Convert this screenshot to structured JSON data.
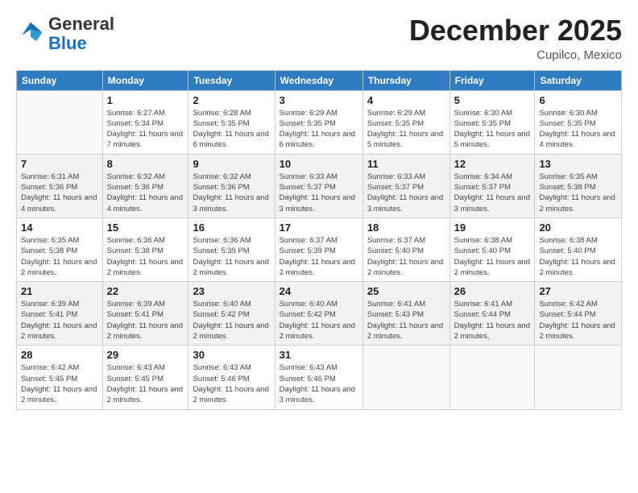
{
  "header": {
    "logo_general": "General",
    "logo_blue": "Blue",
    "month_title": "December 2025",
    "location": "Cupilco, Mexico"
  },
  "days_of_week": [
    "Sunday",
    "Monday",
    "Tuesday",
    "Wednesday",
    "Thursday",
    "Friday",
    "Saturday"
  ],
  "weeks": [
    {
      "row_class": "row-a",
      "days": [
        {
          "number": "",
          "empty": true
        },
        {
          "number": "1",
          "sunrise": "6:27 AM",
          "sunset": "5:34 PM",
          "daylight": "11 hours and 7 minutes."
        },
        {
          "number": "2",
          "sunrise": "6:28 AM",
          "sunset": "5:35 PM",
          "daylight": "11 hours and 6 minutes."
        },
        {
          "number": "3",
          "sunrise": "6:29 AM",
          "sunset": "5:35 PM",
          "daylight": "11 hours and 6 minutes."
        },
        {
          "number": "4",
          "sunrise": "6:29 AM",
          "sunset": "5:35 PM",
          "daylight": "11 hours and 5 minutes."
        },
        {
          "number": "5",
          "sunrise": "6:30 AM",
          "sunset": "5:35 PM",
          "daylight": "11 hours and 5 minutes."
        },
        {
          "number": "6",
          "sunrise": "6:30 AM",
          "sunset": "5:35 PM",
          "daylight": "11 hours and 4 minutes."
        }
      ]
    },
    {
      "row_class": "row-b",
      "days": [
        {
          "number": "7",
          "sunrise": "6:31 AM",
          "sunset": "5:36 PM",
          "daylight": "11 hours and 4 minutes."
        },
        {
          "number": "8",
          "sunrise": "6:32 AM",
          "sunset": "5:36 PM",
          "daylight": "11 hours and 4 minutes."
        },
        {
          "number": "9",
          "sunrise": "6:32 AM",
          "sunset": "5:36 PM",
          "daylight": "11 hours and 3 minutes."
        },
        {
          "number": "10",
          "sunrise": "6:33 AM",
          "sunset": "5:37 PM",
          "daylight": "11 hours and 3 minutes."
        },
        {
          "number": "11",
          "sunrise": "6:33 AM",
          "sunset": "5:37 PM",
          "daylight": "11 hours and 3 minutes."
        },
        {
          "number": "12",
          "sunrise": "6:34 AM",
          "sunset": "5:37 PM",
          "daylight": "11 hours and 3 minutes."
        },
        {
          "number": "13",
          "sunrise": "6:35 AM",
          "sunset": "5:38 PM",
          "daylight": "11 hours and 2 minutes."
        }
      ]
    },
    {
      "row_class": "row-c",
      "days": [
        {
          "number": "14",
          "sunrise": "6:35 AM",
          "sunset": "5:38 PM",
          "daylight": "11 hours and 2 minutes."
        },
        {
          "number": "15",
          "sunrise": "6:36 AM",
          "sunset": "5:38 PM",
          "daylight": "11 hours and 2 minutes."
        },
        {
          "number": "16",
          "sunrise": "6:36 AM",
          "sunset": "5:39 PM",
          "daylight": "11 hours and 2 minutes."
        },
        {
          "number": "17",
          "sunrise": "6:37 AM",
          "sunset": "5:39 PM",
          "daylight": "11 hours and 2 minutes."
        },
        {
          "number": "18",
          "sunrise": "6:37 AM",
          "sunset": "5:40 PM",
          "daylight": "11 hours and 2 minutes."
        },
        {
          "number": "19",
          "sunrise": "6:38 AM",
          "sunset": "5:40 PM",
          "daylight": "11 hours and 2 minutes."
        },
        {
          "number": "20",
          "sunrise": "6:38 AM",
          "sunset": "5:40 PM",
          "daylight": "11 hours and 2 minutes."
        }
      ]
    },
    {
      "row_class": "row-d",
      "days": [
        {
          "number": "21",
          "sunrise": "6:39 AM",
          "sunset": "5:41 PM",
          "daylight": "11 hours and 2 minutes."
        },
        {
          "number": "22",
          "sunrise": "6:39 AM",
          "sunset": "5:41 PM",
          "daylight": "11 hours and 2 minutes."
        },
        {
          "number": "23",
          "sunrise": "6:40 AM",
          "sunset": "5:42 PM",
          "daylight": "11 hours and 2 minutes."
        },
        {
          "number": "24",
          "sunrise": "6:40 AM",
          "sunset": "5:42 PM",
          "daylight": "11 hours and 2 minutes."
        },
        {
          "number": "25",
          "sunrise": "6:41 AM",
          "sunset": "5:43 PM",
          "daylight": "11 hours and 2 minutes."
        },
        {
          "number": "26",
          "sunrise": "6:41 AM",
          "sunset": "5:44 PM",
          "daylight": "11 hours and 2 minutes."
        },
        {
          "number": "27",
          "sunrise": "6:42 AM",
          "sunset": "5:44 PM",
          "daylight": "11 hours and 2 minutes."
        }
      ]
    },
    {
      "row_class": "row-e",
      "days": [
        {
          "number": "28",
          "sunrise": "6:42 AM",
          "sunset": "5:45 PM",
          "daylight": "11 hours and 2 minutes."
        },
        {
          "number": "29",
          "sunrise": "6:43 AM",
          "sunset": "5:45 PM",
          "daylight": "11 hours and 2 minutes."
        },
        {
          "number": "30",
          "sunrise": "6:43 AM",
          "sunset": "5:46 PM",
          "daylight": "11 hours and 2 minutes."
        },
        {
          "number": "31",
          "sunrise": "6:43 AM",
          "sunset": "5:46 PM",
          "daylight": "11 hours and 3 minutes."
        },
        {
          "number": "",
          "empty": true
        },
        {
          "number": "",
          "empty": true
        },
        {
          "number": "",
          "empty": true
        }
      ]
    }
  ],
  "labels": {
    "sunrise": "Sunrise:",
    "sunset": "Sunset:",
    "daylight": "Daylight:"
  }
}
